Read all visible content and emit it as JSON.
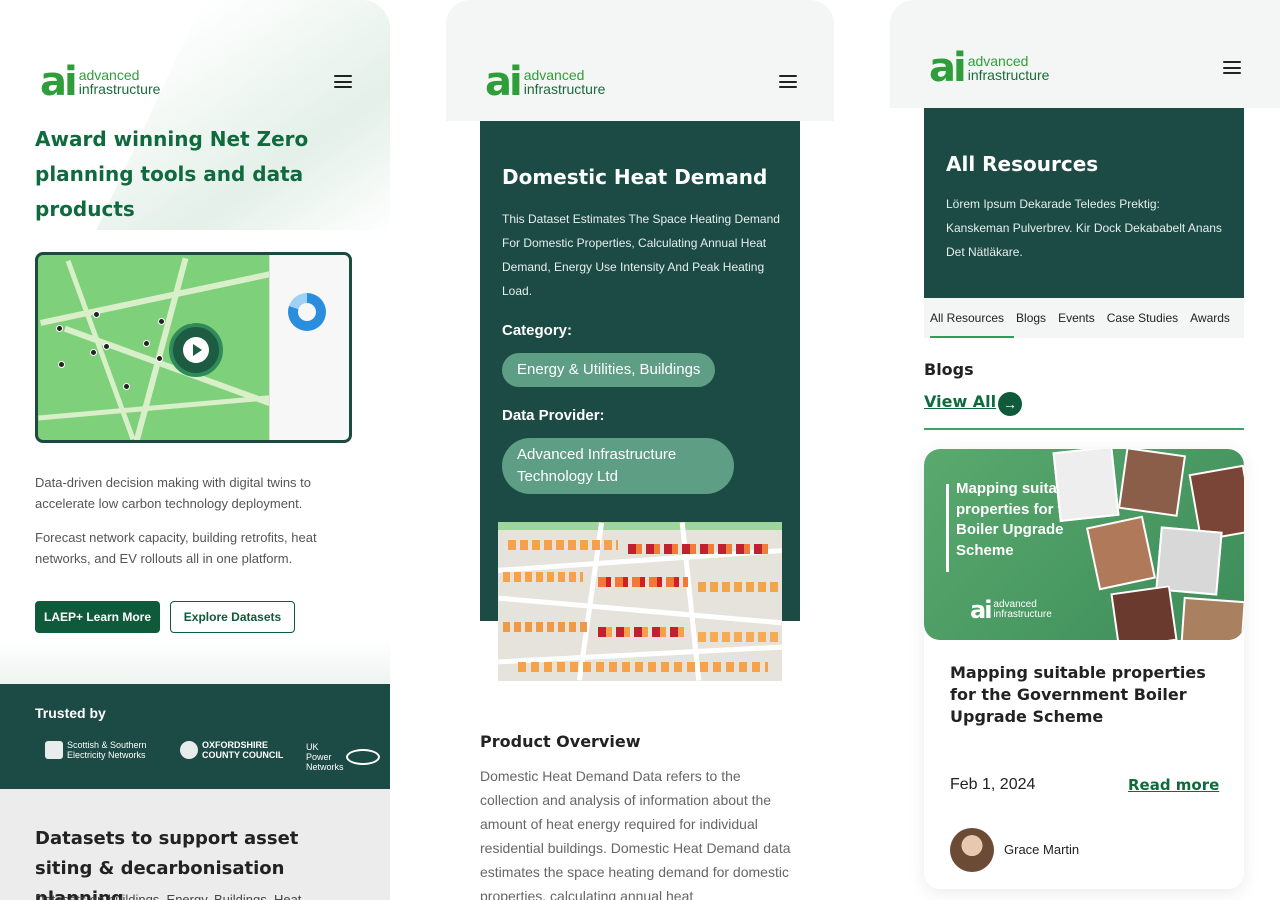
{
  "brand": {
    "logo_mark": "ai",
    "logo_line1": "advanced",
    "logo_line2": "infrastructure"
  },
  "panel1": {
    "hero_title": "Award winning Net Zero planning tools and data products",
    "para1": "Data-driven decision making with digital twins to accelerate low carbon technology deployment.",
    "para2": "Forecast network capacity, building retrofits, heat networks, and EV rollouts all in one platform.",
    "btn_primary": "LAEP+ Learn More",
    "btn_secondary": "Explore Datasets",
    "trusted_title": "Trusted by",
    "partners": [
      {
        "line1": "Scottish & Southern",
        "line2": "Electricity Networks"
      },
      {
        "line1": "OXFORDSHIRE",
        "line2": "COUNTY COUNCIL"
      },
      {
        "line1": "UK",
        "line2": "Power",
        "line3": "Networks"
      }
    ],
    "datasets_title": "Datasets to support asset siting & decarbonisation planning",
    "datasets_sub": "Datasets on buildings, Energy, Buildings, Heat"
  },
  "panel2": {
    "title": "Domestic Heat Demand",
    "description": "This Dataset Estimates The Space Heating Demand For Domestic Properties, Calculating Annual Heat Demand, Energy Use Intensity And Peak Heating Load.",
    "category_label": "Category:",
    "category_value": "Energy & Utilities, Buildings",
    "provider_label": "Data Provider:",
    "provider_value": "Advanced Infrastructure Technology Ltd",
    "overview_title": "Product Overview",
    "overview_body": "Domestic Heat Demand Data refers to the collection and analysis of information about the amount of heat energy required for individual residential buildings. Domestic Heat Demand data estimates the space heating demand for domestic properties, calculating annual heat"
  },
  "panel3": {
    "title": "All Resources",
    "description": "Lörem Ipsum Dekarade Teledes Prektig: Kanskeman Pulverbrev. Kir Dock Dekababelt Anans Det Nätläkare.",
    "tabs": [
      "All Resources",
      "Blogs",
      "Events",
      "Case Studies",
      "Awards"
    ],
    "section_title": "Blogs",
    "view_all": "View All",
    "blog": {
      "image_text": "Mapping suitable properties for the Boiler Upgrade Scheme",
      "title": "Mapping suitable properties for the Government Boiler Upgrade Scheme",
      "date": "Feb 1, 2024",
      "read_more": "Read more",
      "author": "Grace Martin"
    }
  },
  "colors": {
    "brand_green": "#2f9e3a",
    "dark_teal": "#1c4a44",
    "button_green": "#0f5a3a",
    "pill_green": "#5d9e84"
  }
}
